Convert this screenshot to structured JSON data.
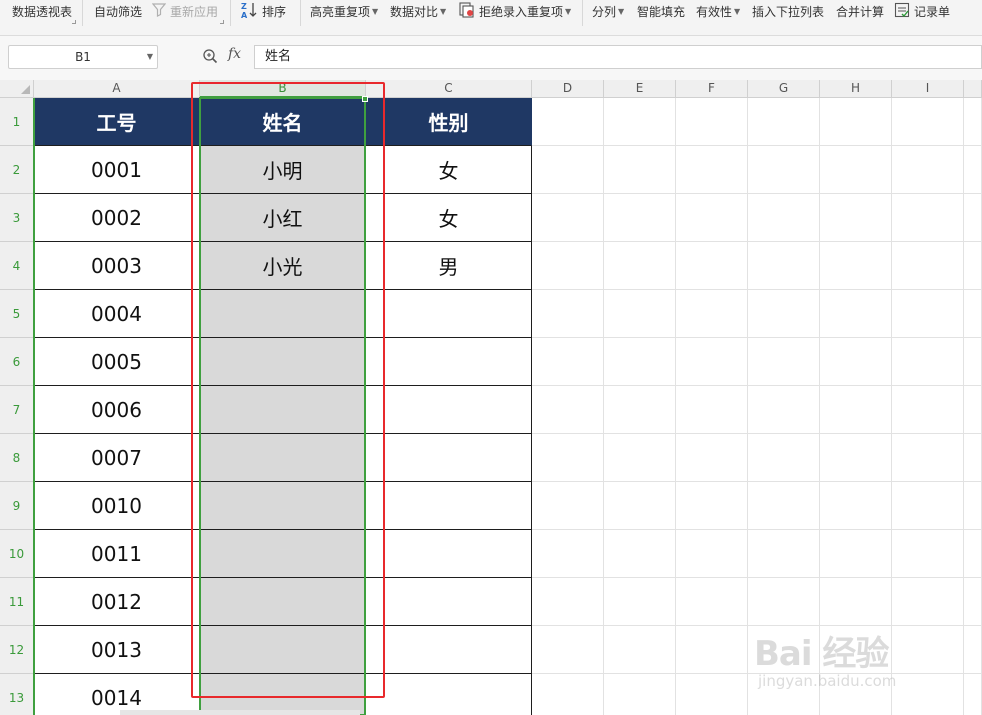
{
  "toolbar": {
    "items": [
      {
        "label": "数据透视表"
      },
      {
        "label": "自动筛选"
      },
      {
        "label": "重新应用"
      },
      {
        "label": "排序"
      },
      {
        "label": "高亮重复项"
      },
      {
        "label": "数据对比"
      },
      {
        "label": "拒绝录入重复项"
      },
      {
        "label": "分列"
      },
      {
        "label": "智能填充"
      },
      {
        "label": "有效性"
      },
      {
        "label": "插入下拉列表"
      },
      {
        "label": "合并计算"
      },
      {
        "label": "记录单"
      }
    ]
  },
  "formula_bar": {
    "cell_ref": "B1",
    "fx_label": "fx",
    "value": "姓名"
  },
  "sheet": {
    "columns": [
      "A",
      "B",
      "C",
      "D",
      "E",
      "F",
      "G",
      "H",
      "I"
    ],
    "selected_column": "B",
    "rows": [
      {
        "num": "1",
        "cells": [
          "工号",
          "姓名",
          "性别"
        ]
      },
      {
        "num": "2",
        "cells": [
          "0001",
          "小明",
          "女"
        ]
      },
      {
        "num": "3",
        "cells": [
          "0002",
          "小红",
          "女"
        ]
      },
      {
        "num": "4",
        "cells": [
          "0003",
          "小光",
          "男"
        ]
      },
      {
        "num": "5",
        "cells": [
          "0004",
          "",
          ""
        ]
      },
      {
        "num": "6",
        "cells": [
          "0005",
          "",
          ""
        ]
      },
      {
        "num": "7",
        "cells": [
          "0006",
          "",
          ""
        ]
      },
      {
        "num": "8",
        "cells": [
          "0007",
          "",
          ""
        ]
      },
      {
        "num": "9",
        "cells": [
          "0010",
          "",
          ""
        ]
      },
      {
        "num": "10",
        "cells": [
          "0011",
          "",
          ""
        ]
      },
      {
        "num": "11",
        "cells": [
          "0012",
          "",
          ""
        ]
      },
      {
        "num": "12",
        "cells": [
          "0013",
          "",
          ""
        ]
      },
      {
        "num": "13",
        "cells": [
          "0014",
          "",
          ""
        ]
      }
    ]
  },
  "watermark": {
    "main": "Bai 经验",
    "sub": "jingyan.baidu.com"
  },
  "colors": {
    "header_fill": "#1f3864",
    "selection_green": "#3fa03f",
    "highlight_red": "#e8292c",
    "selected_fill": "#d9d9d9"
  }
}
